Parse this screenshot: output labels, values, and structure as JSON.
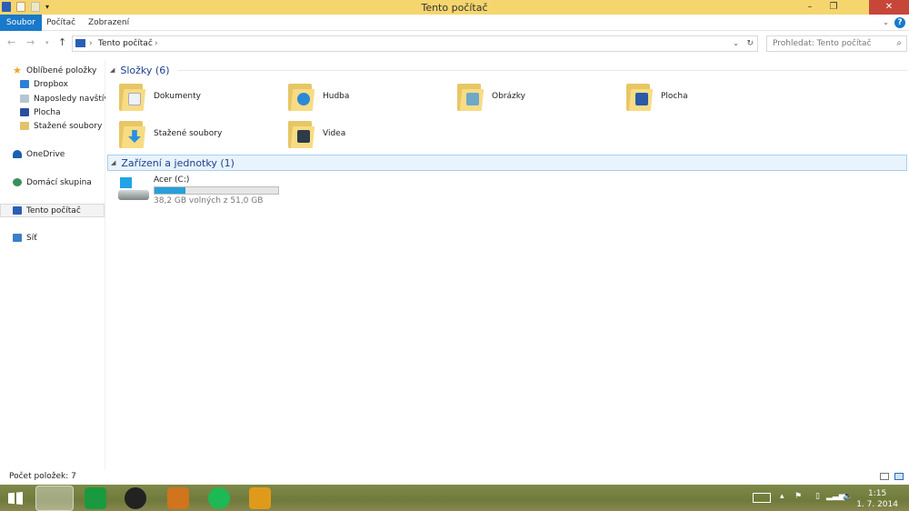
{
  "window": {
    "title": "Tento počítač",
    "minimize": "–",
    "maximize": "❐",
    "close": "✕"
  },
  "ribbon": {
    "tabs": [
      "Soubor",
      "Počítač",
      "Zobrazení"
    ],
    "help": "?"
  },
  "address": {
    "back": "←",
    "forward": "→",
    "up": "↑",
    "path": "Tento počítač",
    "sep": "›",
    "search_placeholder": "Prohledat: Tento počítač"
  },
  "sidebar": {
    "items": [
      "Oblíbené položky",
      "Dropbox",
      "Naposledy navštívené",
      "Plocha",
      "Stažené soubory",
      "OneDrive",
      "Domácí skupina",
      "Tento počítač",
      "Síť"
    ]
  },
  "groups": {
    "folders": "Složky (6)",
    "devices": "Zařízení a jednotky (1)"
  },
  "folders": [
    "Dokumenty",
    "Hudba",
    "Obrázky",
    "Plocha",
    "Stažené soubory",
    "Videa"
  ],
  "drive": {
    "name": "Acer (C:)",
    "free": "38,2 GB volných z 51,0 GB",
    "used_percent": 25
  },
  "status": {
    "count": "Počet položek: 7"
  },
  "taskbar": {
    "time": "1:15",
    "date": "1. 7. 2014"
  }
}
